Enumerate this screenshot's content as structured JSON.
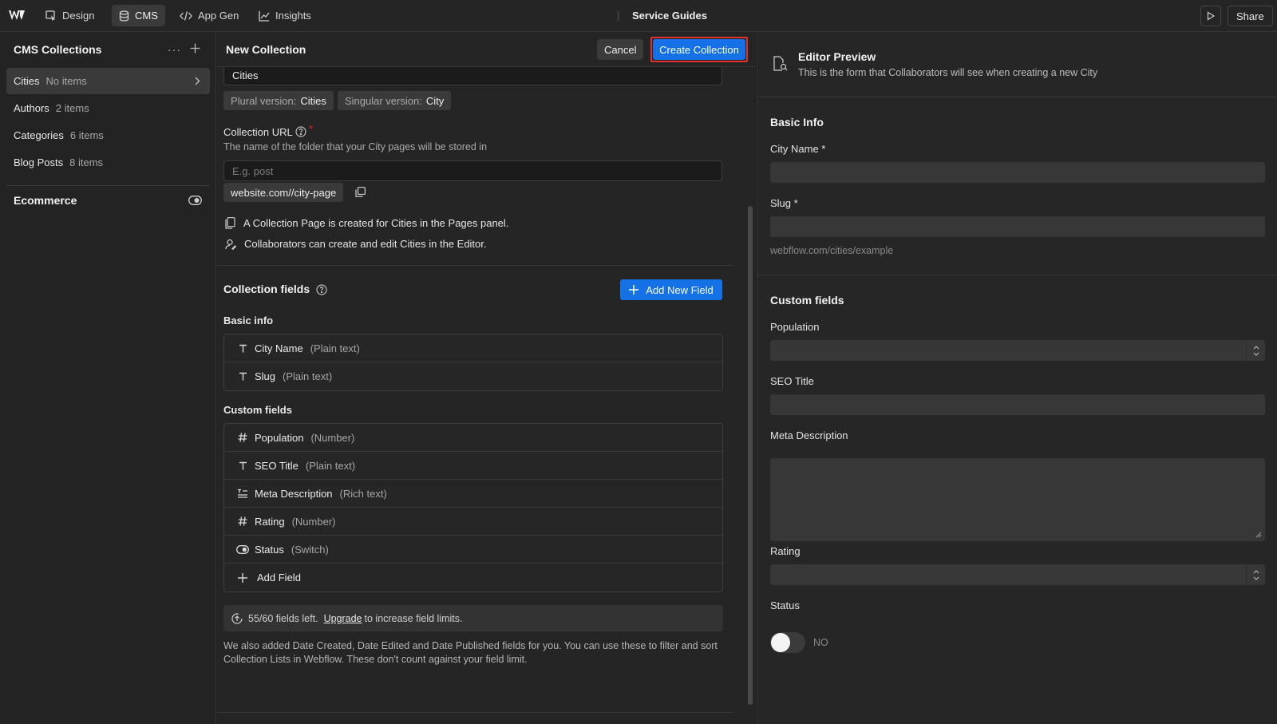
{
  "topbar": {
    "tabs": [
      {
        "label": "Design",
        "icon": "cursor-icon"
      },
      {
        "label": "CMS",
        "icon": "database-icon"
      },
      {
        "label": "App Gen",
        "icon": "code-icon"
      },
      {
        "label": "Insights",
        "icon": "chart-icon"
      }
    ],
    "active_tab": "CMS",
    "site_title": "Service Guides",
    "share_label": "Share"
  },
  "sidebar": {
    "title": "CMS Collections",
    "more_label": "···",
    "collections": [
      {
        "name": "Cities",
        "count": "No items"
      },
      {
        "name": "Authors",
        "count": "2 items"
      },
      {
        "name": "Categories",
        "count": "6 items"
      },
      {
        "name": "Blog Posts",
        "count": "8 items"
      }
    ],
    "ecommerce_label": "Ecommerce"
  },
  "editor": {
    "title": "New Collection",
    "cancel_label": "Cancel",
    "create_label": "Create Collection",
    "name_value": "Cities",
    "plural_label": "Plural version:",
    "plural_value": "Cities",
    "singular_label": "Singular version:",
    "singular_value": "City",
    "url_label": "Collection URL",
    "url_required": "*",
    "url_help": "The name of the folder that your City pages will be stored in",
    "url_placeholder": "E.g. post",
    "url_preview": "website.com//city-page",
    "notes": [
      "A Collection Page is created for Cities in the Pages panel.",
      "Collaborators can create and edit Cities in the Editor."
    ],
    "fields_title": "Collection fields",
    "add_new_field_label": "Add New Field",
    "basic_info_title": "Basic info",
    "basic_fields": [
      {
        "name": "City Name",
        "type": "(Plain text)"
      },
      {
        "name": "Slug",
        "type": "(Plain text)"
      }
    ],
    "custom_fields_title": "Custom fields",
    "custom_fields": [
      {
        "name": "Population",
        "type": "(Number)"
      },
      {
        "name": "SEO Title",
        "type": "(Plain text)"
      },
      {
        "name": "Meta Description",
        "type": "(Rich text)"
      },
      {
        "name": "Rating",
        "type": "(Number)"
      },
      {
        "name": "Status",
        "type": "(Switch)"
      }
    ],
    "add_field_label": "Add Field",
    "fields_left": "55/60 fields left.",
    "upgrade_label": "Upgrade",
    "upgrade_suffix": "to increase field limits.",
    "footnote": "We also added Date Created, Date Edited and Date Published fields for you. You can use these to filter and sort Collection Lists in Webflow. These don't count against your field limit."
  },
  "preview": {
    "title": "Editor Preview",
    "subtitle": "This is the form that Collaborators will see when creating a new City",
    "basic_title": "Basic Info",
    "city_name_label": "City Name *",
    "slug_label": "Slug *",
    "slug_hint": "webflow.com/cities/example",
    "custom_title": "Custom fields",
    "population_label": "Population",
    "seo_title_label": "SEO Title",
    "meta_label": "Meta Description",
    "rating_label": "Rating",
    "status_label": "Status",
    "status_value": "NO"
  },
  "colors": {
    "accent": "#1471e6",
    "highlight": "#e0312e",
    "background": "#1e1e1e"
  }
}
